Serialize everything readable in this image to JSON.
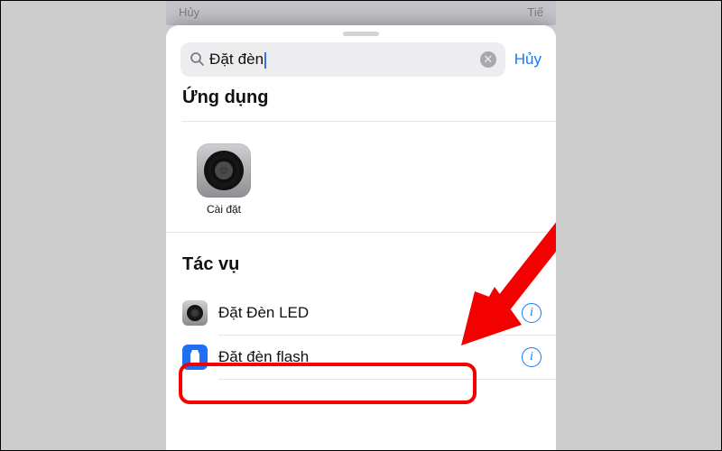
{
  "behind": {
    "left": "Hủy",
    "right": "Tiế"
  },
  "search": {
    "value": "Đặt đèn",
    "cancel_label": "Hủy"
  },
  "sections": {
    "apps_title": "Ứng dụng",
    "actions_title": "Tác vụ"
  },
  "apps": [
    {
      "label": "Cài đặt",
      "icon": "settings-icon"
    }
  ],
  "actions": [
    {
      "label": "Đặt Đèn LED",
      "icon": "settings",
      "name": "action-set-led"
    },
    {
      "label": "Đặt đèn flash",
      "icon": "flashlight",
      "name": "action-set-flash"
    }
  ],
  "annotations": {
    "highlight_target": "action-set-led"
  },
  "colors": {
    "accent": "#0a7cff",
    "highlight": "#f30100"
  }
}
